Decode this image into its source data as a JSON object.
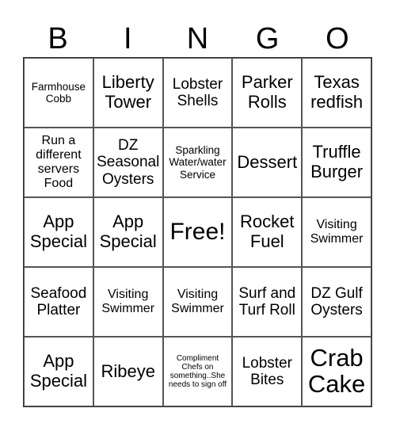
{
  "header": {
    "letters": [
      "B",
      "I",
      "N",
      "G",
      "O"
    ]
  },
  "board": {
    "rows": [
      [
        "Farmhouse Cobb",
        "Liberty Tower",
        "Lobster Shells",
        "Parker Rolls",
        "Texas redfish"
      ],
      [
        "Run a different servers Food",
        "DZ Seasonal Oysters",
        "Sparkling Water/water Service",
        "Dessert",
        "Truffle Burger"
      ],
      [
        "App Special",
        "App Special",
        "Free!",
        "Rocket Fuel",
        "Visiting Swimmer"
      ],
      [
        "Seafood Platter",
        "Visiting Swimmer",
        "Visiting Swimmer",
        "Surf and Turf Roll",
        "DZ Gulf Oysters"
      ],
      [
        "App Special",
        "Ribeye",
        "Compliment Chefs on something..She needs to sign off",
        "Lobster Bites",
        "Crab Cake"
      ]
    ]
  }
}
